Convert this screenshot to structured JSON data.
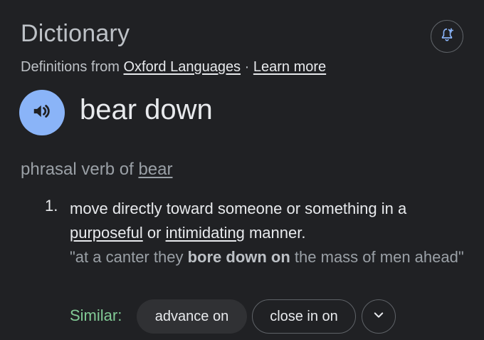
{
  "header": {
    "title": "Dictionary",
    "source_prefix": "Definitions from",
    "source_link": "Oxford Languages",
    "separator": "·",
    "learn_more": "Learn more"
  },
  "entry": {
    "headword": "bear down",
    "pos_label": "phrasal verb of",
    "root_word": "bear",
    "senses": [
      {
        "number": "1.",
        "def_part1": "move directly toward someone or something in a",
        "def_link1": "purposeful",
        "def_part2": "or",
        "def_link2": "intimidating",
        "def_part3": "manner.",
        "example_open": "\"at a canter they",
        "example_bold": "bore down on",
        "example_close": "the mass of men ahead\""
      }
    ]
  },
  "similar": {
    "label": "Similar:",
    "chips": [
      "advance on",
      "close in on"
    ]
  },
  "icons": {
    "alert": "bell-plus-icon",
    "audio": "speaker-icon",
    "more": "chevron-down-icon"
  },
  "colors": {
    "background": "#202124",
    "accent_blue": "#8ab4f8",
    "similar_green": "#81c995"
  }
}
